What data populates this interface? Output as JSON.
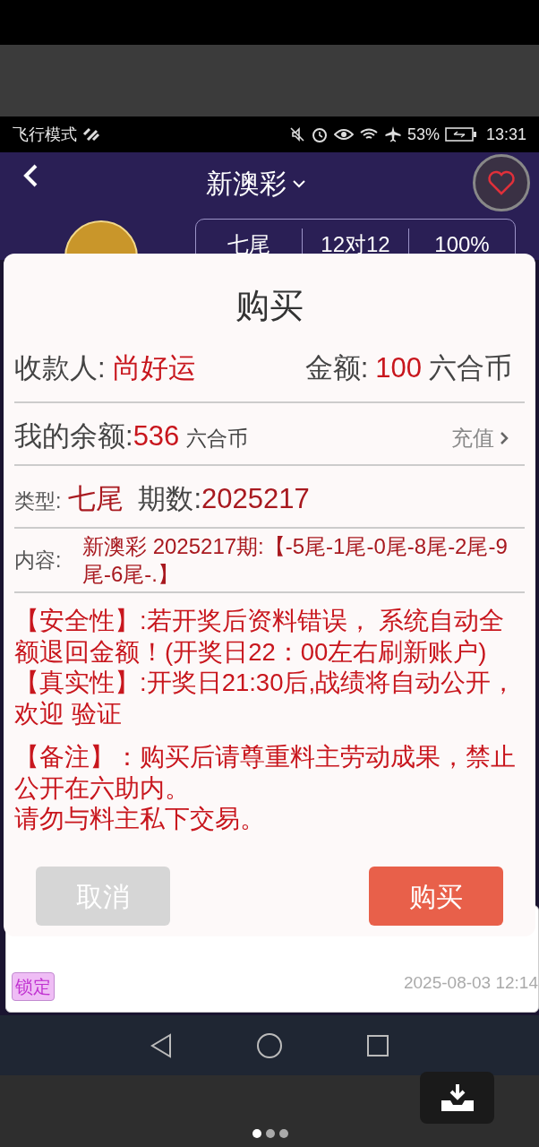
{
  "status_bar": {
    "left": "飞行模式",
    "battery": "53%",
    "time": "13:31"
  },
  "header": {
    "title": "新澳彩",
    "stats": [
      "七尾",
      "12对12",
      "100%"
    ]
  },
  "dialog": {
    "title": "购买",
    "payee_label": "收款人:",
    "payee": "尚好运",
    "amount_label": "金额:",
    "amount": "100",
    "amount_unit": "六合币",
    "balance_label": "我的余额:",
    "balance": "536",
    "balance_unit": "六合币",
    "recharge": "充值",
    "type_label": "类型:",
    "type": "七尾",
    "period_label": "期数:",
    "period": "2025217",
    "content_label": "内容:",
    "content": "新澳彩 2025217期:【-5尾-1尾-0尾-8尾-2尾-9尾-6尾-.】",
    "notes": [
      "【安全性】:若开奖后资料错误， 系统自动全额退回金额！(开奖日22：00左右刷新账户)",
      "【真实性】:开奖日21:30后,战绩将自动公开，欢迎 验证",
      "【备注】：购买后请尊重料主劳动成果，禁止公开在六助内。",
      "请勿与料主私下交易。"
    ],
    "buttons": [
      {
        "label": "取消",
        "kind": "cancel"
      },
      {
        "label": "购买",
        "kind": "confirm"
      }
    ]
  },
  "card": {
    "badge": "锁定",
    "time": "2025-08-03 12:14"
  },
  "pager": [
    {
      "selected": true
    },
    {
      "selected": false
    },
    {
      "selected": false
    }
  ]
}
